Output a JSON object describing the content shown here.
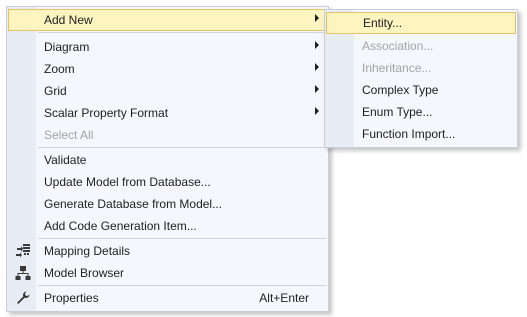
{
  "main_menu": {
    "items": [
      {
        "label": "Add New",
        "submenu": true
      },
      {
        "label": "Diagram",
        "submenu": true
      },
      {
        "label": "Zoom",
        "submenu": true
      },
      {
        "label": "Grid",
        "submenu": true
      },
      {
        "label": "Scalar Property Format",
        "submenu": true
      },
      {
        "label": "Select All",
        "disabled": true
      },
      {
        "label": "Validate"
      },
      {
        "label": "Update Model from Database..."
      },
      {
        "label": "Generate Database from Model..."
      },
      {
        "label": "Add Code Generation Item..."
      },
      {
        "label": "Mapping Details",
        "icon": "mapping-details-icon"
      },
      {
        "label": "Model Browser",
        "icon": "model-browser-icon"
      },
      {
        "label": "Properties",
        "icon": "wrench-icon",
        "shortcut": "Alt+Enter"
      }
    ]
  },
  "add_new_submenu": {
    "items": [
      {
        "label": "Entity..."
      },
      {
        "label": "Association...",
        "disabled": true
      },
      {
        "label": "Inheritance...",
        "disabled": true
      },
      {
        "label": "Complex Type"
      },
      {
        "label": "Enum Type..."
      },
      {
        "label": "Function Import..."
      }
    ]
  },
  "colors": {
    "menu_background": "#f4f7fc",
    "highlight_background": "#fdf4bf",
    "highlight_border": "#e5c365",
    "disabled_text": "#a2a4a5"
  }
}
